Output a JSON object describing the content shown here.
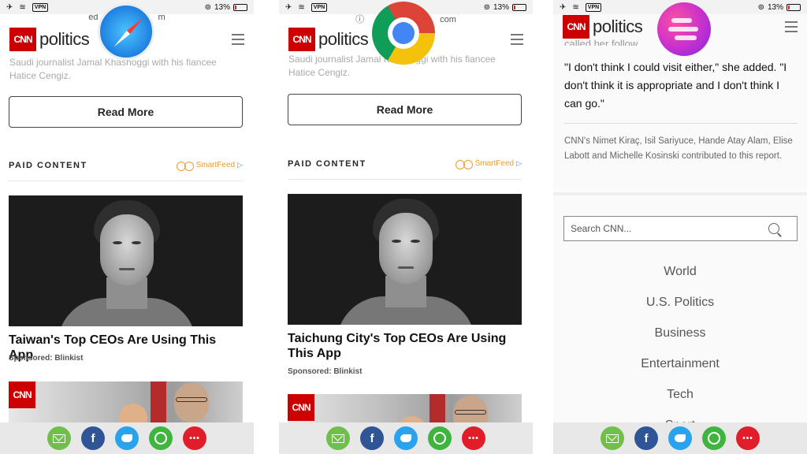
{
  "status": {
    "vpn": "VPN",
    "battery": "13%"
  },
  "panels": [
    {
      "url": "ed",
      "url_tail": "m",
      "logo": "CNN",
      "section": "politics",
      "caption": "Saudi journalist Jamal Khashoggi with his fiancee Hatice Cengiz.",
      "read_more": "Read More",
      "paid_content": "PAID CONTENT",
      "smartfeed": "SmartFeed",
      "ad_headline": "Taiwan's Top CEOs Are Using This App",
      "sponsored": "Sponsored: Blinkist",
      "browser": "safari-icon"
    },
    {
      "url": "com",
      "logo": "CNN",
      "section": "politics",
      "caption": "Saudi journalist Jamal Khashoggi with his fiancee Hatice Cengiz.",
      "read_more": "Read More",
      "paid_content": "PAID CONTENT",
      "smartfeed": "SmartFeed",
      "ad_headline": "Taichung City's Top CEOs Are Using This App",
      "sponsored": "Sponsored: Blinkist",
      "browser": "chrome-icon"
    },
    {
      "logo": "CNN",
      "section": "politics",
      "partial_top": "called her follow… …'s death.",
      "quote": "\"I don't think I could visit either,\" she added. \"I don't think it is appropriate and I don't think I can go.\"",
      "credit": "CNN's Nimet Kiraç, Isil Sariyuce, Hande Atay Alam, Elise Labott and Michelle Kosinski contributed to this report.",
      "search_placeholder": "Search CNN...",
      "nav": [
        "World",
        "U.S. Politics",
        "Business",
        "Entertainment",
        "Tech",
        "Sport"
      ],
      "browser": "firefox-focus-icon"
    }
  ],
  "share": {
    "more": "•••"
  }
}
